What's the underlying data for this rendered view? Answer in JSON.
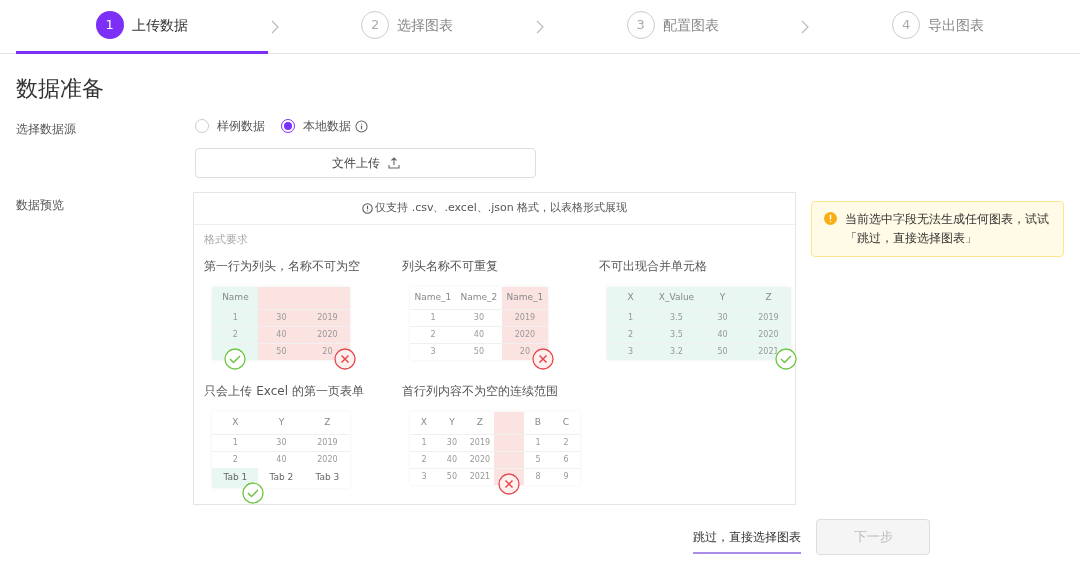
{
  "steps": [
    {
      "number": "1",
      "label": "上传数据",
      "selected": true
    },
    {
      "number": "2",
      "label": "选择图表",
      "selected": false
    },
    {
      "number": "3",
      "label": "配置图表",
      "selected": false
    },
    {
      "number": "4",
      "label": "导出图表",
      "selected": false
    }
  ],
  "title": "数据准备",
  "source": {
    "label": "选择数据源",
    "options": [
      {
        "label": "样例数据",
        "selected": false
      },
      {
        "label": "本地数据",
        "selected": true
      }
    ]
  },
  "upload_button": "文件上传",
  "preview": {
    "label": "数据预览",
    "notice": "仅支持 .csv、.excel、.json 格式，以表格形式展现",
    "section": "格式要求",
    "examples": [
      {
        "title": "第一行为列头，名称不可为空",
        "columns": [
          {
            "header": "Name",
            "color": "#e8f7f1",
            "check": true,
            "cross": false
          },
          {
            "color": "#fbe3e1",
            "check": false,
            "cross": false
          },
          {
            "color": "#fbe3e1",
            "check": false,
            "cross": true
          }
        ],
        "rows": [
          [
            "1",
            "30",
            "2019"
          ],
          [
            "2",
            "40",
            "2020"
          ],
          [
            null,
            "50",
            "20"
          ]
        ]
      },
      {
        "title": "列头名称不可重复",
        "columns": [
          {
            "header": "Name_1",
            "color": "#ffffff",
            "check": false,
            "cross": false
          },
          {
            "header": "Name_2",
            "color": "#ffffff",
            "check": false,
            "cross": false
          },
          {
            "header": "Name_1",
            "color": "#fbe3e1",
            "check": false,
            "cross": true
          }
        ],
        "rows": [
          [
            "1",
            "30",
            "2019"
          ],
          [
            "2",
            "40",
            "2020"
          ],
          [
            "3",
            "50",
            "20"
          ]
        ]
      },
      {
        "title": "不可出现合并单元格",
        "columns": [
          {
            "header": "X",
            "color": "#e8f7f1",
            "check": false,
            "cross": false
          },
          {
            "header": "X_Value",
            "color": "#e8f7f1",
            "check": false,
            "cross": false
          },
          {
            "header": "Y",
            "color": "#e8f7f1",
            "check": false,
            "cross": false
          },
          {
            "header": "Z",
            "color": "#e8f7f1",
            "check": true,
            "cross": false
          }
        ],
        "rows": [
          [
            "1",
            "3.5",
            "30",
            "2019"
          ],
          [
            "2",
            "3.5",
            "40",
            "2020"
          ],
          [
            "3",
            "3.2",
            "50",
            "2021"
          ]
        ]
      },
      {
        "title": "只会上传 Excel 的第一页表单",
        "columns": [
          {
            "header": "X",
            "color": "#ffffff",
            "check": true,
            "cross": false
          },
          {
            "header": "Y",
            "color": "#ffffff",
            "check": false,
            "cross": false
          },
          {
            "header": "Z",
            "color": "#ffffff",
            "check": false,
            "cross": false
          }
        ],
        "rows": [
          [
            "1",
            "30",
            "2019"
          ],
          [
            "2",
            "40",
            "2020"
          ]
        ],
        "tabs": [
          {
            "label": "Tab 1",
            "selected": true
          },
          {
            "label": "Tab 2",
            "selected": false
          },
          {
            "label": "Tab 3",
            "selected": false
          }
        ]
      },
      {
        "title": "首行列内容不为空的连续范围",
        "columns": [
          {
            "header": "X",
            "color": "#ffffff",
            "check": false,
            "cross": false
          },
          {
            "header": "Y",
            "color": "#ffffff",
            "check": false,
            "cross": false
          },
          {
            "header": "Z",
            "color": "#ffffff",
            "check": false,
            "cross": false
          },
          {
            "color": "#fbe3e1",
            "check": false,
            "cross": true
          },
          {
            "header": "B",
            "color": "#ffffff",
            "check": false,
            "cross": false
          },
          {
            "header": "C",
            "color": "#ffffff",
            "check": false,
            "cross": false
          }
        ],
        "rows": [
          [
            "1",
            "30",
            "2019",
            null,
            "1",
            "2"
          ],
          [
            "2",
            "40",
            "2020",
            null,
            "5",
            "6"
          ],
          [
            "3",
            "50",
            "2021",
            null,
            "8",
            "9"
          ]
        ]
      }
    ]
  },
  "warning": "当前选中字段无法生成任何图表，试试「跳过，直接选择图表」",
  "skip_link": "跳过，直接选择图表",
  "next_button": {
    "label": "下一步",
    "disabled": true
  }
}
